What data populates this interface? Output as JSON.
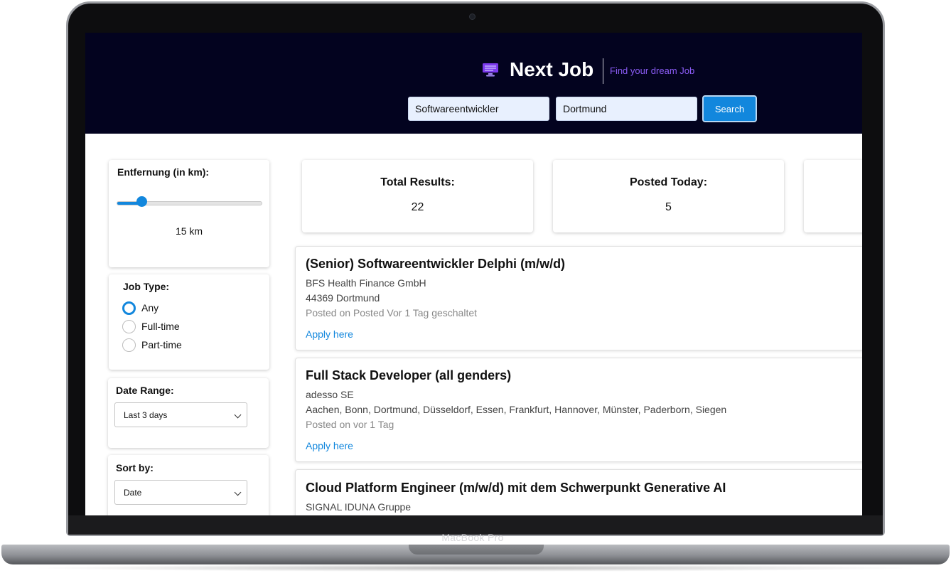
{
  "brand": {
    "title": "Next Job",
    "tagline": "Find your dream Job",
    "logo_icon": "monitor-icon",
    "accent_color": "#8b5cf6"
  },
  "search": {
    "keyword_value": "Softwareentwickler",
    "location_value": "Dortmund",
    "button_label": "Search"
  },
  "filters": {
    "distance": {
      "label": "Entfernung (in km):",
      "value_text": "15 km",
      "fraction": 0.17
    },
    "job_type": {
      "label": "Job Type:",
      "options": [
        "Any",
        "Full-time",
        "Part-time"
      ],
      "selected": "Any"
    },
    "date_range": {
      "label": "Date Range:",
      "selected": "Last 3 days"
    },
    "sort_by": {
      "label": "Sort by:",
      "selected": "Date"
    }
  },
  "stats": [
    {
      "label": "Total Results:",
      "value": "22"
    },
    {
      "label": "Posted Today:",
      "value": "5"
    }
  ],
  "jobs": [
    {
      "title": "(Senior) Softwareentwickler Delphi (m/w/d)",
      "company": "BFS Health Finance GmbH",
      "location": "44369 Dortmund",
      "posted": "Posted on Posted Vor 1 Tag geschaltet",
      "apply_label": "Apply here"
    },
    {
      "title": "Full Stack Developer (all genders)",
      "company": "adesso SE",
      "location": "Aachen, Bonn, Dortmund, Düsseldorf, Essen, Frankfurt, Hannover, Münster, Paderborn, Siegen",
      "posted": "Posted on vor 1 Tag",
      "apply_label": "Apply here"
    },
    {
      "title": "Cloud Platform Engineer (m/w/d) mit dem Schwerpunkt Generative AI",
      "company": "SIGNAL IDUNA Gruppe",
      "location": "",
      "posted": "",
      "apply_label": ""
    }
  ],
  "device": {
    "model_label": "MacBook Pro"
  },
  "colors": {
    "header_bg": "#03031f",
    "primary": "#1287dd",
    "search_field_bg": "#e8f0fe"
  }
}
